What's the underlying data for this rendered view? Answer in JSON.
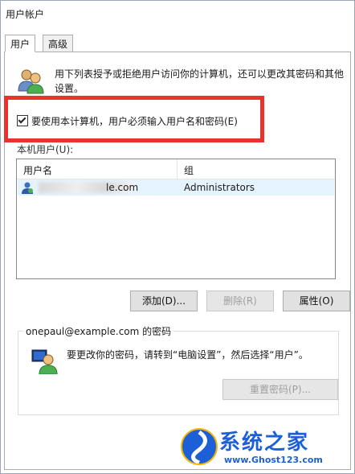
{
  "window": {
    "title": "用户帐户"
  },
  "tabs": [
    {
      "label": "用户",
      "active": true
    },
    {
      "label": "高级",
      "active": false
    }
  ],
  "intro_text": "用下列表授予或拒绝用户访问你的计算机，还可以更改其密码和其他设置。",
  "require_login": {
    "label": "要使用本计算机，用户必须输入用户名和密码(E)",
    "checked": true
  },
  "users_label": "本机用户(U):",
  "users_table": {
    "columns": [
      "用户名",
      "组"
    ],
    "rows": [
      {
        "username": "le.com",
        "group": "Administrators"
      }
    ]
  },
  "buttons": {
    "add": "添加(D)...",
    "remove": "删除(R)",
    "properties": "属性(O)"
  },
  "password_section": {
    "title": "onepaul@example.com 的密码",
    "text": "要更改你的密码，请转到“电脑设置”，然后选择“用户”。",
    "reset_button": "重置密码(P)..."
  },
  "watermark": {
    "brand": "系统之家",
    "url": "www.Ghost123.com"
  }
}
